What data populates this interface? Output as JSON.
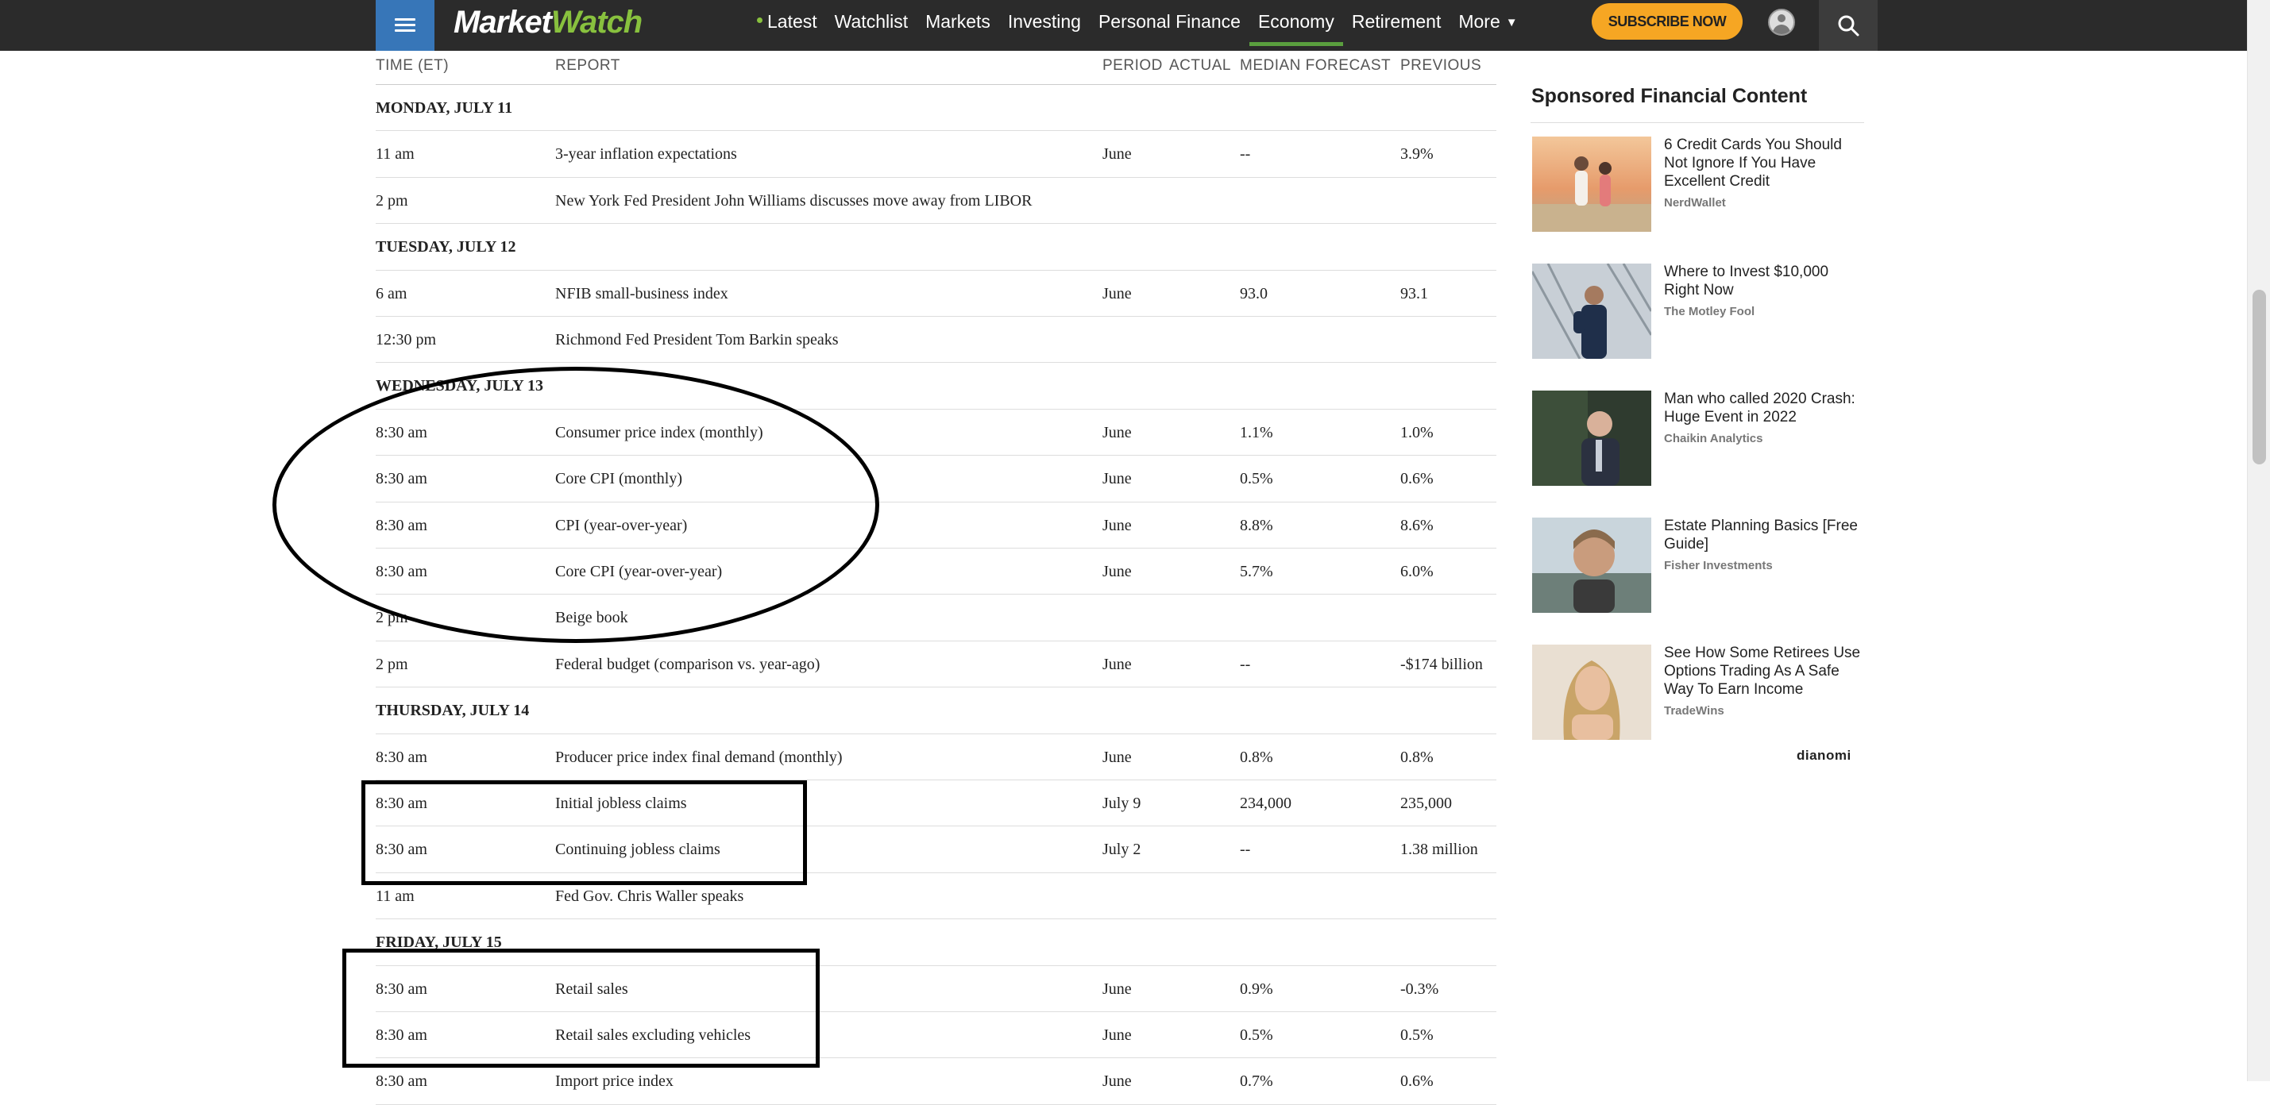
{
  "nav": {
    "logo_market": "Market",
    "logo_watch": "Watch",
    "items": [
      "Latest",
      "Watchlist",
      "Markets",
      "Investing",
      "Personal Finance",
      "Economy",
      "Retirement",
      "More"
    ],
    "active_item": "Economy",
    "subscribe_label": "SUBSCRIBE NOW",
    "accent_color": "#3776b8",
    "subscribe_color": "#f6a623",
    "icons": [
      "menu-icon",
      "user-icon",
      "search-icon",
      "chevron-down-icon"
    ]
  },
  "table": {
    "headers": {
      "time": "TIME (ET)",
      "report": "REPORT",
      "period": "PERIOD",
      "actual": "ACTUAL",
      "median": "MEDIAN FORECAST",
      "previous": "PREVIOUS"
    },
    "rows": [
      {
        "day": "MONDAY, JULY 11"
      },
      {
        "time": "11 am",
        "report": "3-year inflation expectations",
        "period": "June",
        "actual": "",
        "median": "--",
        "previous": "3.9%"
      },
      {
        "time": "2 pm",
        "report": "New York Fed President John Williams discusses move away from LIBOR",
        "period": "",
        "actual": "",
        "median": "",
        "previous": ""
      },
      {
        "day": "TUESDAY, JULY 12"
      },
      {
        "time": "6 am",
        "report": "NFIB small-business index",
        "period": "June",
        "actual": "",
        "median": "93.0",
        "previous": "93.1"
      },
      {
        "time": "12:30 pm",
        "report": "Richmond Fed President Tom Barkin speaks",
        "period": "",
        "actual": "",
        "median": "",
        "previous": ""
      },
      {
        "day": "WEDNESDAY, JULY 13"
      },
      {
        "time": "8:30 am",
        "report": "Consumer price index (monthly)",
        "period": "June",
        "actual": "",
        "median": "1.1%",
        "previous": "1.0%"
      },
      {
        "time": "8:30 am",
        "report": "Core CPI (monthly)",
        "period": "June",
        "actual": "",
        "median": "0.5%",
        "previous": "0.6%"
      },
      {
        "time": "8:30 am",
        "report": "CPI (year-over-year)",
        "period": "June",
        "actual": "",
        "median": "8.8%",
        "previous": "8.6%"
      },
      {
        "time": "8:30 am",
        "report": "Core CPI (year-over-year)",
        "period": "June",
        "actual": "",
        "median": "5.7%",
        "previous": "6.0%"
      },
      {
        "time": "2 pm",
        "report": "Beige book",
        "period": "",
        "actual": "",
        "median": "",
        "previous": ""
      },
      {
        "time": "2 pm",
        "report": "Federal budget (comparison vs. year-ago)",
        "period": "June",
        "actual": "",
        "median": "--",
        "previous": "-$174 billion"
      },
      {
        "day": "THURSDAY, JULY 14"
      },
      {
        "time": "8:30 am",
        "report": "Producer price index final demand (monthly)",
        "period": "June",
        "actual": "",
        "median": "0.8%",
        "previous": "0.8%"
      },
      {
        "time": "8:30 am",
        "report": "Initial jobless claims",
        "period": "July 9",
        "actual": "",
        "median": "234,000",
        "previous": "235,000"
      },
      {
        "time": "8:30 am",
        "report": "Continuing jobless claims",
        "period": "July 2",
        "actual": "",
        "median": "--",
        "previous": "1.38 million"
      },
      {
        "time": "11 am",
        "report": "Fed Gov. Chris Waller speaks",
        "period": "",
        "actual": "",
        "median": "",
        "previous": ""
      },
      {
        "day": "FRIDAY, JULY 15"
      },
      {
        "time": "8:30 am",
        "report": "Retail sales",
        "period": "June",
        "actual": "",
        "median": "0.9%",
        "previous": "-0.3%"
      },
      {
        "time": "8:30 am",
        "report": "Retail sales excluding vehicles",
        "period": "June",
        "actual": "",
        "median": "0.5%",
        "previous": "0.5%"
      },
      {
        "time": "8:30 am",
        "report": "Import price index",
        "period": "June",
        "actual": "",
        "median": "0.7%",
        "previous": "0.6%"
      }
    ]
  },
  "sponsored": {
    "title": "Sponsored Financial Content",
    "items": [
      {
        "headline": "6 Credit Cards You Should Not Ignore If You Have Excellent Credit",
        "source": "NerdWallet"
      },
      {
        "headline": "Where to Invest $10,000 Right Now",
        "source": "The Motley Fool"
      },
      {
        "headline": "Man who called 2020 Crash: Huge Event in 2022",
        "source": "Chaikin Analytics"
      },
      {
        "headline": "Estate Planning Basics [Free Guide]",
        "source": "Fisher Investments"
      },
      {
        "headline": "See How Some Retirees Use Options Trading As A Safe Way To Earn Income",
        "source": "TradeWins"
      }
    ],
    "provider": "dianomi"
  }
}
